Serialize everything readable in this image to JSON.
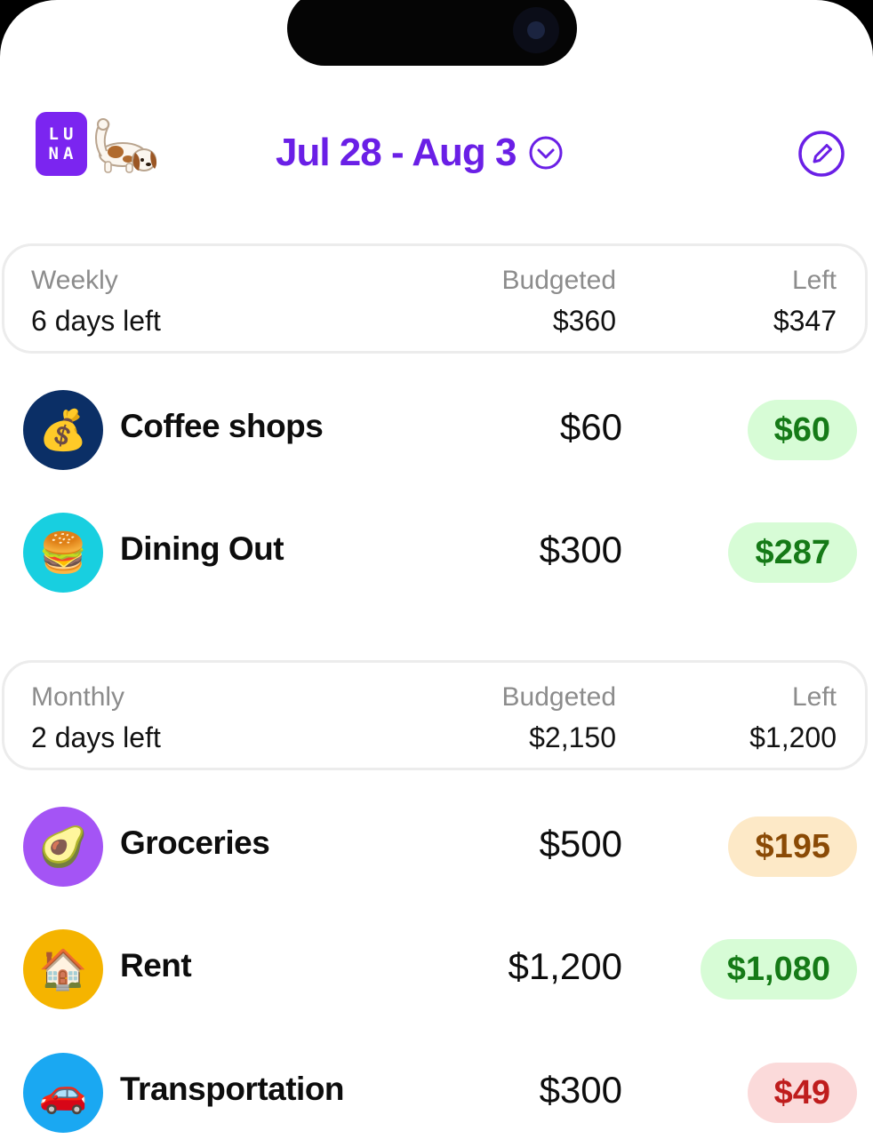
{
  "header": {
    "logo_text": "LUNA",
    "date_range": "Jul 28 - Aug 3"
  },
  "weekly": {
    "period_label": "Weekly",
    "days_left": "6 days left",
    "budgeted_label": "Budgeted",
    "budgeted_value": "$360",
    "left_label": "Left",
    "left_value": "$347",
    "categories": [
      {
        "icon": "money-bag-icon",
        "emoji": "💰",
        "circle_color": "#0b2f66",
        "name": "Coffee shops",
        "budgeted": "$60",
        "left": "$60",
        "status": "green"
      },
      {
        "icon": "burger-icon",
        "emoji": "🍔",
        "circle_color": "#18cfe0",
        "name": "Dining Out",
        "budgeted": "$300",
        "left": "$287",
        "status": "green"
      }
    ]
  },
  "monthly": {
    "period_label": "Monthly",
    "days_left": "2 days left",
    "budgeted_label": "Budgeted",
    "budgeted_value": "$2,150",
    "left_label": "Left",
    "left_value": "$1,200",
    "categories": [
      {
        "icon": "avocado-icon",
        "emoji": "🥑",
        "circle_color": "#a454f5",
        "name": "Groceries",
        "budgeted": "$500",
        "left": "$195",
        "status": "orange"
      },
      {
        "icon": "house-icon",
        "emoji": "🏠",
        "circle_color": "#f5b400",
        "name": "Rent",
        "budgeted": "$1,200",
        "left": "$1,080",
        "status": "green"
      },
      {
        "icon": "car-icon",
        "emoji": "🚗",
        "circle_color": "#1aa8f2",
        "name": "Transportation",
        "budgeted": "$300",
        "left": "$49",
        "status": "red"
      }
    ]
  },
  "colors": {
    "accent": "#6a1fe6",
    "logo": "#7b25f0",
    "pill_green": "#d7fcd6",
    "pill_orange": "#fde9c7",
    "pill_red": "#fbdada"
  }
}
